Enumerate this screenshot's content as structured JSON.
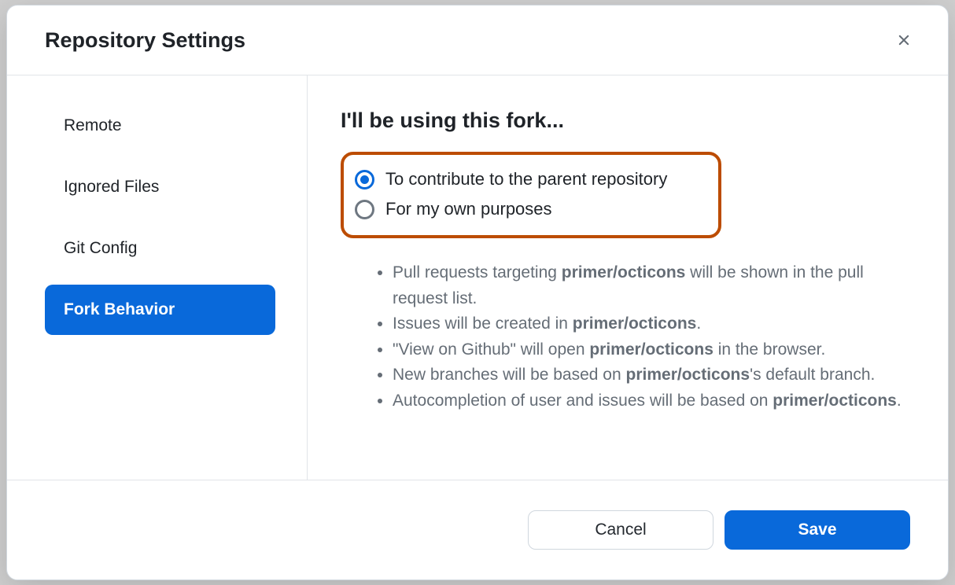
{
  "dialog": {
    "title": "Repository Settings"
  },
  "sidebar": {
    "items": [
      {
        "label": "Remote",
        "active": false
      },
      {
        "label": "Ignored Files",
        "active": false
      },
      {
        "label": "Git Config",
        "active": false
      },
      {
        "label": "Fork Behavior",
        "active": true
      }
    ]
  },
  "content": {
    "heading": "I'll be using this fork...",
    "options": {
      "contribute": {
        "label": "To contribute to the parent repository",
        "selected": true
      },
      "own": {
        "label": "For my own purposes",
        "selected": false
      }
    },
    "repo_slug": "primer/octicons",
    "details": {
      "li1_a": "Pull requests targeting ",
      "li1_b": " will be shown in the pull request list.",
      "li2_a": "Issues will be created in ",
      "li2_b": ".",
      "li3_a": "\"View on Github\" will open ",
      "li3_b": " in the browser.",
      "li4_a": "New branches will be based on ",
      "li4_b": "'s default branch.",
      "li5_a": "Autocompletion of user and issues will be based on ",
      "li5_b": "."
    }
  },
  "footer": {
    "cancel": "Cancel",
    "save": "Save"
  }
}
